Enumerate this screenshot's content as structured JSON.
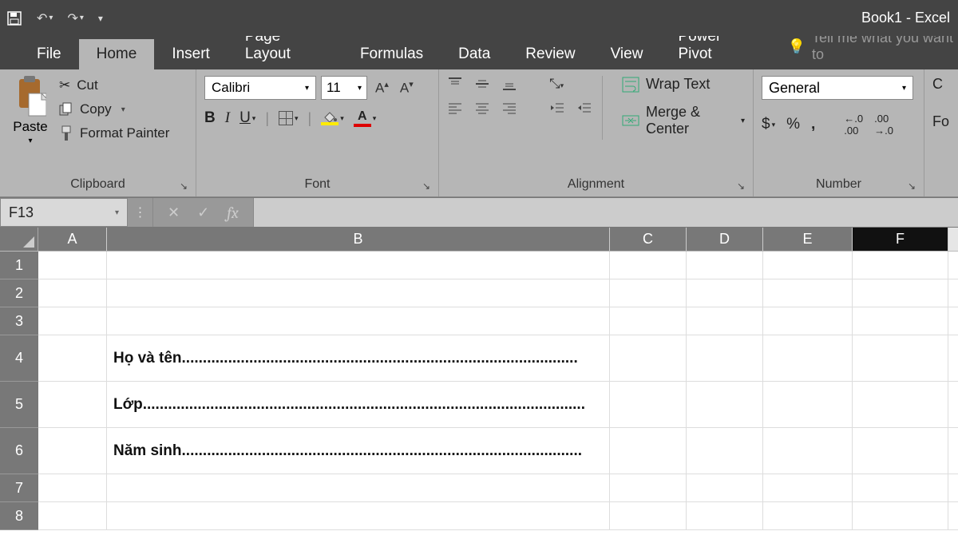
{
  "app": {
    "title": "Book1 - Excel"
  },
  "tabs": {
    "file": "File",
    "home": "Home",
    "insert": "Insert",
    "pagelayout": "Page Layout",
    "formulas": "Formulas",
    "data": "Data",
    "review": "Review",
    "view": "View",
    "powerpivot": "Power Pivot",
    "tellme": "Tell me what you want to"
  },
  "clipboard": {
    "paste": "Paste",
    "cut": "Cut",
    "copy": "Copy",
    "format_painter": "Format Painter",
    "group_label": "Clipboard"
  },
  "font": {
    "name": "Calibri",
    "size": "11",
    "group_label": "Font",
    "bold": "B",
    "italic": "I",
    "underline": "U",
    "font_color_letter": "A"
  },
  "alignment": {
    "wrap": "Wrap Text",
    "merge": "Merge & Center",
    "group_label": "Alignment"
  },
  "number": {
    "format": "General",
    "currency": "$",
    "percent": "%",
    "comma": ",",
    "inc_dec": ".0",
    "dec_inc": ".00",
    "group_label": "Number"
  },
  "right_cut": {
    "line1": "C",
    "line2": "Fo"
  },
  "namebox": "F13",
  "fx": "fx",
  "columns": [
    "A",
    "B",
    "C",
    "D",
    "E",
    "F"
  ],
  "selected_col": "F",
  "rows": [
    "1",
    "2",
    "3",
    "4",
    "5",
    "6",
    "7",
    "8"
  ],
  "cells": {
    "B4": "Họ và tên..............................................................................................",
    "B5": "Lớp.........................................................................................................",
    "B6": "Năm sinh..............................................................................................."
  }
}
